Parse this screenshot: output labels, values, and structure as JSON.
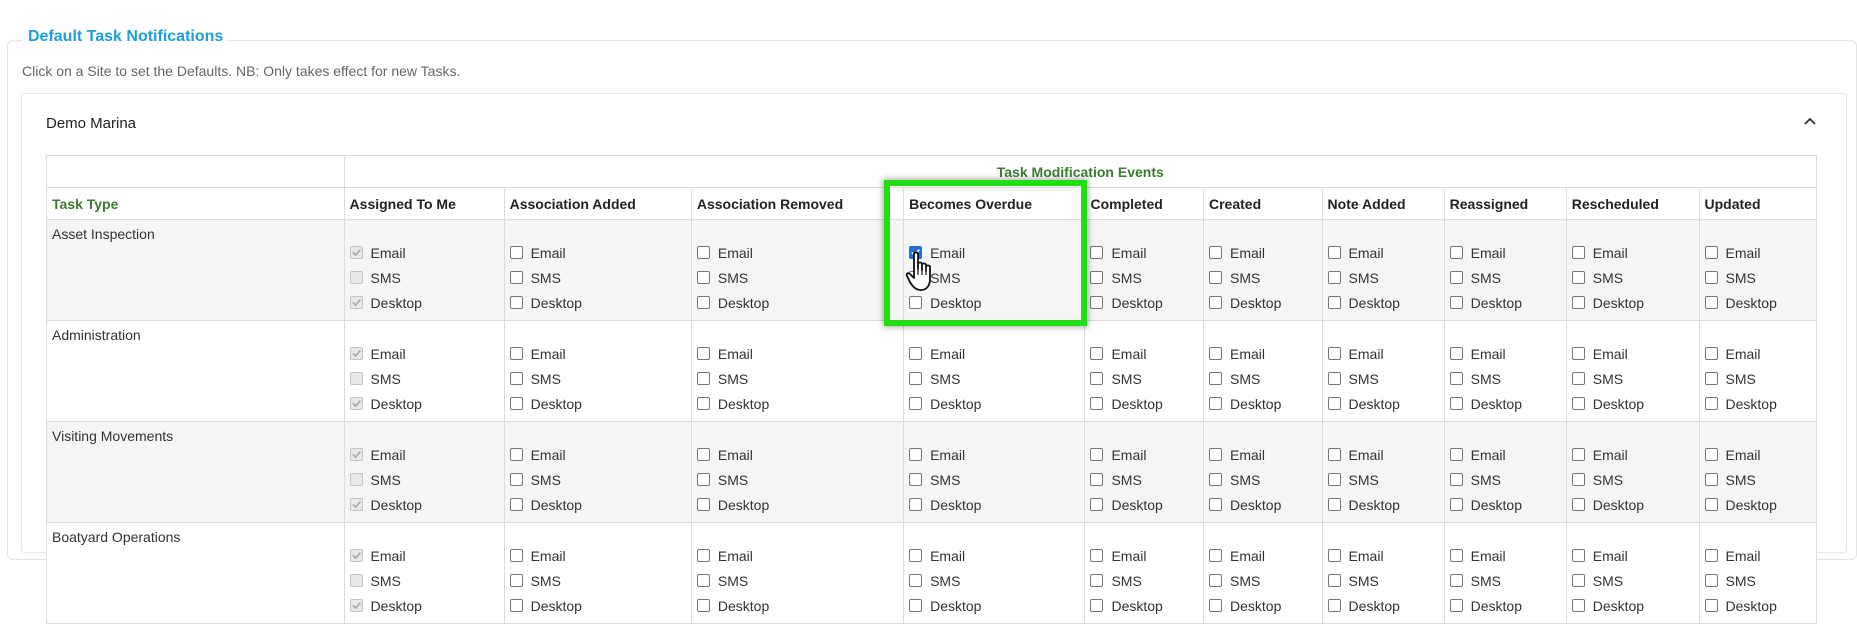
{
  "section": {
    "title": "Default Task Notifications",
    "hint": "Click on a Site to set the Defaults. NB: Only takes effect for new Tasks."
  },
  "site": {
    "name": "Demo Marina",
    "expanded": true
  },
  "table": {
    "group_header": "Task Modification Events",
    "type_header": "Task Type",
    "columns": [
      "Assigned To Me",
      "Association Added",
      "Association Removed",
      "Becomes Overdue",
      "Completed",
      "Created",
      "Note Added",
      "Reassigned",
      "Rescheduled",
      "Updated"
    ],
    "option_labels": [
      "Email",
      "SMS",
      "Desktop"
    ],
    "rows": [
      {
        "type": "Asset Inspection"
      },
      {
        "type": "Administration"
      },
      {
        "type": "Visiting Movements"
      },
      {
        "type": "Boatyard Operations"
      }
    ]
  },
  "checkbox_states": {
    "assigned_to_me": {
      "email": "checked-disabled",
      "sms": "unchecked-disabled",
      "desktop": "checked-disabled"
    },
    "asset_inspection_becomes_overdue_email": "checked",
    "other": "unchecked"
  },
  "colors": {
    "accent": "#1ea0d6",
    "header_green": "#3d7a33",
    "highlight": "#22dd11",
    "checkbox_checked": "#1f6fd6"
  },
  "icons": {
    "collapse": "chevron-up-icon",
    "cursor": "hand-pointer-icon"
  }
}
